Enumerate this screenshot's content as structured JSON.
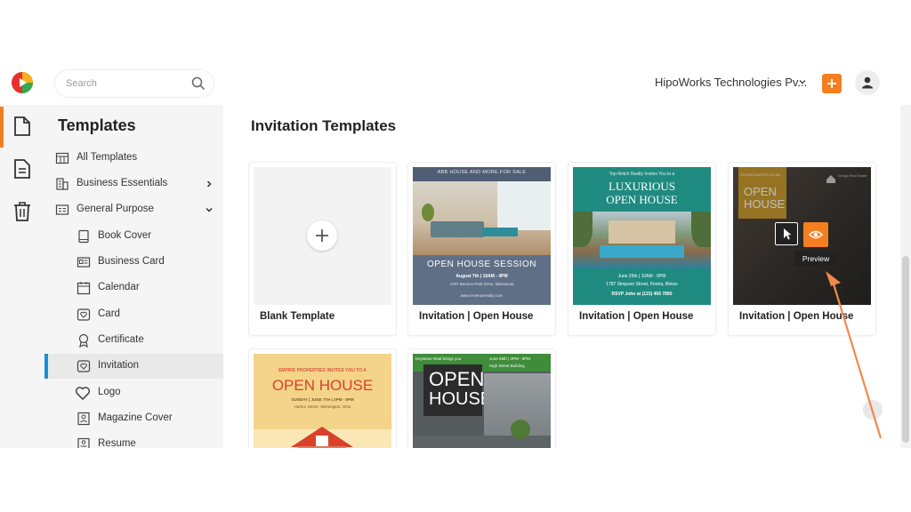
{
  "topbar": {
    "search_placeholder": "Search",
    "org_name": "HipoWorks Technologies Pv...",
    "add_label": "+"
  },
  "sidebar": {
    "title": "Templates",
    "items": [
      {
        "label": "All Templates",
        "icon": "grid-icon"
      },
      {
        "label": "Business Essentials",
        "icon": "building-icon"
      },
      {
        "label": "General Purpose",
        "icon": "list-card-icon"
      },
      {
        "label": "Book Cover",
        "icon": "book-icon"
      },
      {
        "label": "Business Card",
        "icon": "id-card-icon"
      },
      {
        "label": "Calendar",
        "icon": "calendar-icon"
      },
      {
        "label": "Card",
        "icon": "heart-card-icon"
      },
      {
        "label": "Certificate",
        "icon": "ribbon-icon"
      },
      {
        "label": "Invitation",
        "icon": "heart-envelope-icon"
      },
      {
        "label": "Logo",
        "icon": "heart-icon"
      },
      {
        "label": "Magazine Cover",
        "icon": "person-frame-icon"
      },
      {
        "label": "Resume",
        "icon": "resume-icon"
      }
    ]
  },
  "main": {
    "title": "Invitation Templates",
    "cards": [
      {
        "label": "Blank Template"
      },
      {
        "label": "Invitation | Open House",
        "thumb": {
          "top": "ABB HOUSE AND MORE FOR SALE",
          "heading": "OPEN HOUSE SESSION",
          "line1": "August 7th | 10AM - 4PM",
          "line2": "4787 Benson Park Drive, Minnesota",
          "footer": "www.revenuerealty.com"
        }
      },
      {
        "label": "Invitation | Open House",
        "thumb": {
          "top": "Top-Notch Realty Invites You to a",
          "heading1": "LUXURIOUS",
          "heading2": "OPEN HOUSE",
          "line1": "June 25th | 10AM - 6PM",
          "line2": "1787 Simpson Street, Peoria, Illinois",
          "line3": "RSVP John at (123) 456 7890"
        }
      },
      {
        "label": "Invitation | Open House",
        "thumb": {
          "top": "YOU'RE INVITED TO AN",
          "heading1": "OPEN",
          "heading2": "HOUSE",
          "brand": "Design Real Estate",
          "preview": "Preview"
        }
      },
      {
        "label": "",
        "thumb": {
          "top": "EMPIRE PROPERTIES INVITES YOU TO A",
          "heading": "OPEN HOUSE",
          "line1": "SUNDAY | JUNE 7TH | 2PM - 5PM",
          "line2": "Harbor Street, Wilmington, Ohio"
        }
      },
      {
        "label": "",
        "thumb": {
          "top": "Keystone Real brings you",
          "heading1": "OPEN",
          "heading2": "HOUSE",
          "line1": "June 25th | 3PM - 5PM",
          "line2": "High Street Building"
        }
      }
    ]
  },
  "colors": {
    "accent": "#f47f20",
    "active_bar": "#1a90d8",
    "teal": "#1f8a80"
  }
}
